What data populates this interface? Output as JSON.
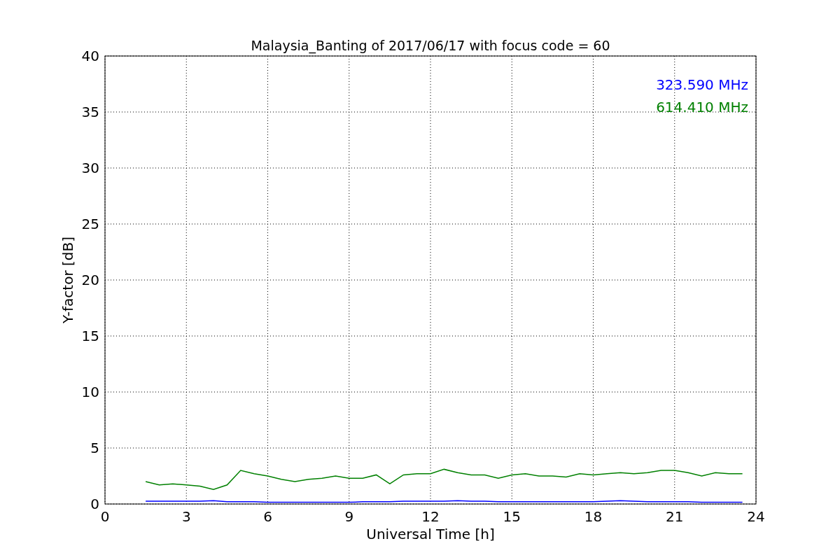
{
  "figure": {
    "chart_data": {
      "type": "line",
      "title": "Malaysia_Banting of 2017/06/17 with focus code = 60",
      "xlabel": "Universal Time [h]",
      "ylabel": "Y-factor [dB]",
      "x": [
        1.5,
        2,
        2.5,
        3,
        3.5,
        4,
        4.5,
        5,
        5.5,
        6,
        6.5,
        7,
        7.5,
        8,
        8.5,
        9,
        9.5,
        10,
        10.5,
        11,
        11.5,
        12,
        12.5,
        13,
        13.5,
        14,
        14.5,
        15,
        15.5,
        16,
        16.5,
        17,
        17.5,
        18,
        18.5,
        19,
        19.5,
        20,
        20.5,
        21,
        21.5,
        22,
        22.5,
        23,
        23.5
      ],
      "series": [
        {
          "name": "323.590 MHz",
          "color": "#0000ff",
          "values": [
            0.25,
            0.25,
            0.25,
            0.25,
            0.25,
            0.3,
            0.2,
            0.2,
            0.2,
            0.15,
            0.15,
            0.15,
            0.15,
            0.15,
            0.15,
            0.15,
            0.2,
            0.2,
            0.2,
            0.25,
            0.25,
            0.25,
            0.25,
            0.3,
            0.25,
            0.25,
            0.2,
            0.2,
            0.2,
            0.2,
            0.2,
            0.2,
            0.2,
            0.2,
            0.25,
            0.3,
            0.25,
            0.2,
            0.2,
            0.2,
            0.2,
            0.15,
            0.15,
            0.15,
            0.15
          ]
        },
        {
          "name": "614.410 MHz",
          "color": "#008000",
          "values": [
            2.0,
            1.7,
            1.8,
            1.7,
            1.6,
            1.3,
            1.7,
            3.0,
            2.7,
            2.5,
            2.2,
            2.0,
            2.2,
            2.3,
            2.5,
            2.3,
            2.3,
            2.6,
            1.8,
            2.6,
            2.7,
            2.7,
            3.1,
            2.8,
            2.6,
            2.6,
            2.3,
            2.6,
            2.7,
            2.5,
            2.5,
            2.4,
            2.7,
            2.6,
            2.7,
            2.8,
            2.7,
            2.8,
            3.0,
            3.0,
            2.8,
            2.5,
            2.8,
            2.7,
            2.7
          ]
        }
      ],
      "xlim": [
        0,
        24
      ],
      "ylim": [
        0,
        40
      ],
      "xticks": [
        0,
        3,
        6,
        9,
        12,
        15,
        18,
        21,
        24
      ],
      "yticks": [
        0,
        5,
        10,
        15,
        20,
        25,
        30,
        35,
        40
      ],
      "grid": true
    }
  }
}
